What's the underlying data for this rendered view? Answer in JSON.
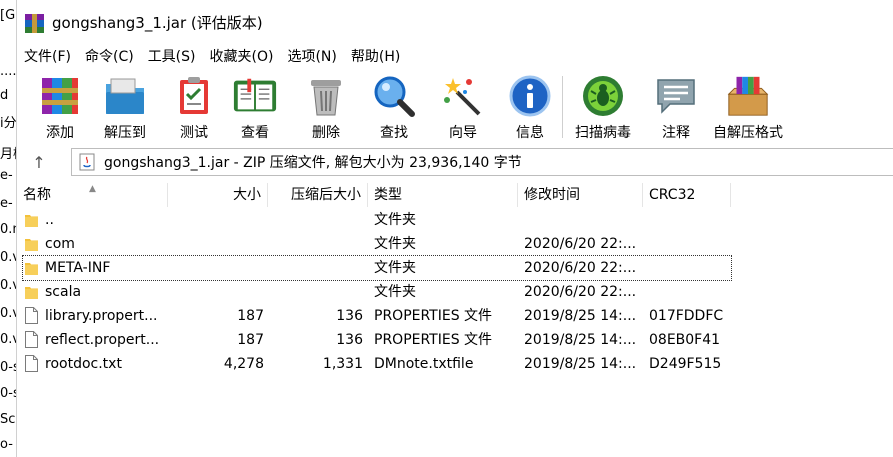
{
  "background_window": {
    "fragments": [
      "[G",
      "....",
      "d",
      "i分",
      "月检",
      "e-",
      "e-",
      "0.n",
      "0.v",
      "0.v",
      "0.v",
      "0.v",
      "0-s",
      "0-s",
      "Sc",
      "o-"
    ]
  },
  "window": {
    "title": "gongshang3_1.jar (评估版本)"
  },
  "menu": [
    {
      "label": "文件(F)"
    },
    {
      "label": "命令(C)"
    },
    {
      "label": "工具(S)"
    },
    {
      "label": "收藏夹(O)"
    },
    {
      "label": "选项(N)"
    },
    {
      "label": "帮助(H)"
    }
  ],
  "toolbar": [
    {
      "label": "添加",
      "icon": "add-archive-icon"
    },
    {
      "label": "解压到",
      "icon": "extract-to-icon"
    },
    {
      "label": "测试",
      "icon": "test-icon"
    },
    {
      "label": "查看",
      "icon": "view-icon"
    },
    {
      "label": "删除",
      "icon": "delete-icon"
    },
    {
      "label": "查找",
      "icon": "find-icon"
    },
    {
      "label": "向导",
      "icon": "wizard-icon"
    },
    {
      "label": "信息",
      "icon": "info-icon"
    },
    {
      "label": "扫描病毒",
      "icon": "virus-scan-icon"
    },
    {
      "label": "注释",
      "icon": "comment-icon"
    },
    {
      "label": "自解压格式",
      "icon": "sfx-icon"
    }
  ],
  "address": {
    "up_icon": "up-arrow-icon",
    "text": "gongshang3_1.jar - ZIP 压缩文件, 解包大小为 23,936,140 字节"
  },
  "columns": {
    "name": "名称",
    "size": "大小",
    "packed": "压缩后大小",
    "type": "类型",
    "modified": "修改时间",
    "crc": "CRC32"
  },
  "files": [
    {
      "name": "..",
      "size": "",
      "packed": "",
      "type": "文件夹",
      "modified": "",
      "crc": "",
      "icon": "folder-icon"
    },
    {
      "name": "com",
      "size": "",
      "packed": "",
      "type": "文件夹",
      "modified": "2020/6/20 22:...",
      "crc": "",
      "icon": "folder-icon"
    },
    {
      "name": "META-INF",
      "size": "",
      "packed": "",
      "type": "文件夹",
      "modified": "2020/6/20 22:...",
      "crc": "",
      "icon": "folder-icon"
    },
    {
      "name": "scala",
      "size": "",
      "packed": "",
      "type": "文件夹",
      "modified": "2020/6/20 22:...",
      "crc": "",
      "icon": "folder-icon"
    },
    {
      "name": "library.propert...",
      "size": "187",
      "packed": "136",
      "type": "PROPERTIES 文件",
      "modified": "2019/8/25 14:...",
      "crc": "017FDDFC",
      "icon": "file-icon"
    },
    {
      "name": "reflect.propert...",
      "size": "187",
      "packed": "136",
      "type": "PROPERTIES 文件",
      "modified": "2019/8/25 14:...",
      "crc": "08EB0F41",
      "icon": "file-icon"
    },
    {
      "name": "rootdoc.txt",
      "size": "4,278",
      "packed": "1,331",
      "type": "DMnote.txtfile",
      "modified": "2019/8/25 14:...",
      "crc": "D249F515",
      "icon": "file-icon"
    }
  ],
  "colors": {
    "folder": "#f3c13a",
    "focus_outline": "#333333",
    "header_border": "#e5e5e5"
  }
}
